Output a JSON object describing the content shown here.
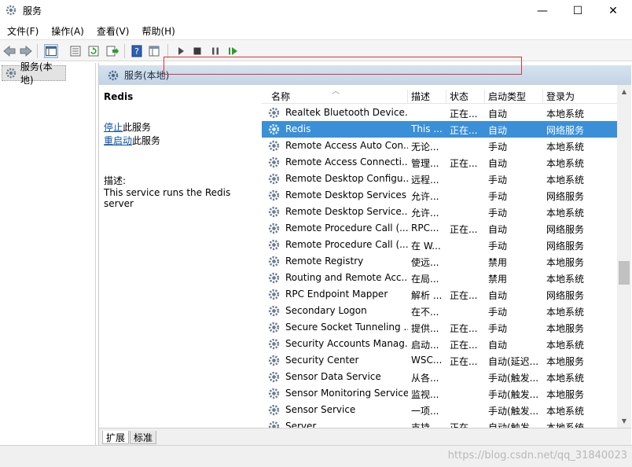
{
  "window": {
    "title": "服务",
    "minimize": "—",
    "maximize": "☐",
    "close": "✕"
  },
  "menu": [
    "文件(F)",
    "操作(A)",
    "查看(V)",
    "帮助(H)"
  ],
  "toolbar": [
    "back-icon",
    "forward-icon",
    "console-tree-icon",
    "properties-icon",
    "refresh-icon",
    "export-icon",
    "help-icon",
    "view-icon",
    "start-icon",
    "stop-icon",
    "pause-icon",
    "restart-icon"
  ],
  "tree": {
    "root": "服务(本地)"
  },
  "header": {
    "title": "服务(本地)"
  },
  "details": {
    "service_name": "Redis",
    "stop_link": "停止",
    "stop_suffix": "此服务",
    "restart_link": "重启动",
    "restart_suffix": "此服务",
    "desc_label": "描述:",
    "desc_text": "This service runs the Redis server"
  },
  "columns": [
    "名称",
    "描述",
    "状态",
    "启动类型",
    "登录为"
  ],
  "rows": [
    {
      "name": "Realtek Bluetooth Device...",
      "desc": "",
      "status": "正在...",
      "startup": "自动",
      "logon": "本地系统"
    },
    {
      "name": "Redis",
      "desc": "This ...",
      "status": "正在...",
      "startup": "自动",
      "logon": "网络服务",
      "selected": true
    },
    {
      "name": "Remote Access Auto Con...",
      "desc": "无论...",
      "status": "",
      "startup": "手动",
      "logon": "本地系统"
    },
    {
      "name": "Remote Access Connecti...",
      "desc": "管理...",
      "status": "正在...",
      "startup": "自动",
      "logon": "本地系统"
    },
    {
      "name": "Remote Desktop Configu...",
      "desc": "远程...",
      "status": "",
      "startup": "手动",
      "logon": "本地系统"
    },
    {
      "name": "Remote Desktop Services",
      "desc": "允许...",
      "status": "",
      "startup": "手动",
      "logon": "网络服务"
    },
    {
      "name": "Remote Desktop Service...",
      "desc": "允许...",
      "status": "",
      "startup": "手动",
      "logon": "本地系统"
    },
    {
      "name": "Remote Procedure Call (...",
      "desc": "RPC...",
      "status": "正在...",
      "startup": "自动",
      "logon": "网络服务"
    },
    {
      "name": "Remote Procedure Call (...",
      "desc": "在 W...",
      "status": "",
      "startup": "手动",
      "logon": "网络服务"
    },
    {
      "name": "Remote Registry",
      "desc": "使远...",
      "status": "",
      "startup": "禁用",
      "logon": "本地服务"
    },
    {
      "name": "Routing and Remote Acc...",
      "desc": "在局...",
      "status": "",
      "startup": "禁用",
      "logon": "本地系统"
    },
    {
      "name": "RPC Endpoint Mapper",
      "desc": "解析 ...",
      "status": "正在...",
      "startup": "自动",
      "logon": "网络服务"
    },
    {
      "name": "Secondary Logon",
      "desc": "在不...",
      "status": "",
      "startup": "手动",
      "logon": "本地系统"
    },
    {
      "name": "Secure Socket Tunneling ...",
      "desc": "提供...",
      "status": "正在...",
      "startup": "手动",
      "logon": "本地服务"
    },
    {
      "name": "Security Accounts Manag...",
      "desc": "启动...",
      "status": "正在...",
      "startup": "自动",
      "logon": "本地系统"
    },
    {
      "name": "Security Center",
      "desc": "WSC...",
      "status": "正在...",
      "startup": "自动(延迟...",
      "logon": "本地服务"
    },
    {
      "name": "Sensor Data Service",
      "desc": "从各...",
      "status": "",
      "startup": "手动(触发...",
      "logon": "本地系统"
    },
    {
      "name": "Sensor Monitoring Service",
      "desc": "监视...",
      "status": "",
      "startup": "手动(触发...",
      "logon": "本地服务"
    },
    {
      "name": "Sensor Service",
      "desc": "一项...",
      "status": "",
      "startup": "手动(触发...",
      "logon": "本地系统"
    },
    {
      "name": "Server",
      "desc": "支持...",
      "status": "正在...",
      "startup": "自动(触发...",
      "logon": "本地系统"
    }
  ],
  "tabs": [
    "扩展",
    "标准"
  ],
  "scroll": {
    "up": "▲",
    "down": "▼",
    "position": 0.55
  },
  "watermark": "https://blog.csdn.net/qq_31840023",
  "colors": {
    "selection": "#3a8fd8",
    "highlight_box": "#e0303a",
    "header": "#c9d9ea",
    "link": "#0a50a8"
  }
}
